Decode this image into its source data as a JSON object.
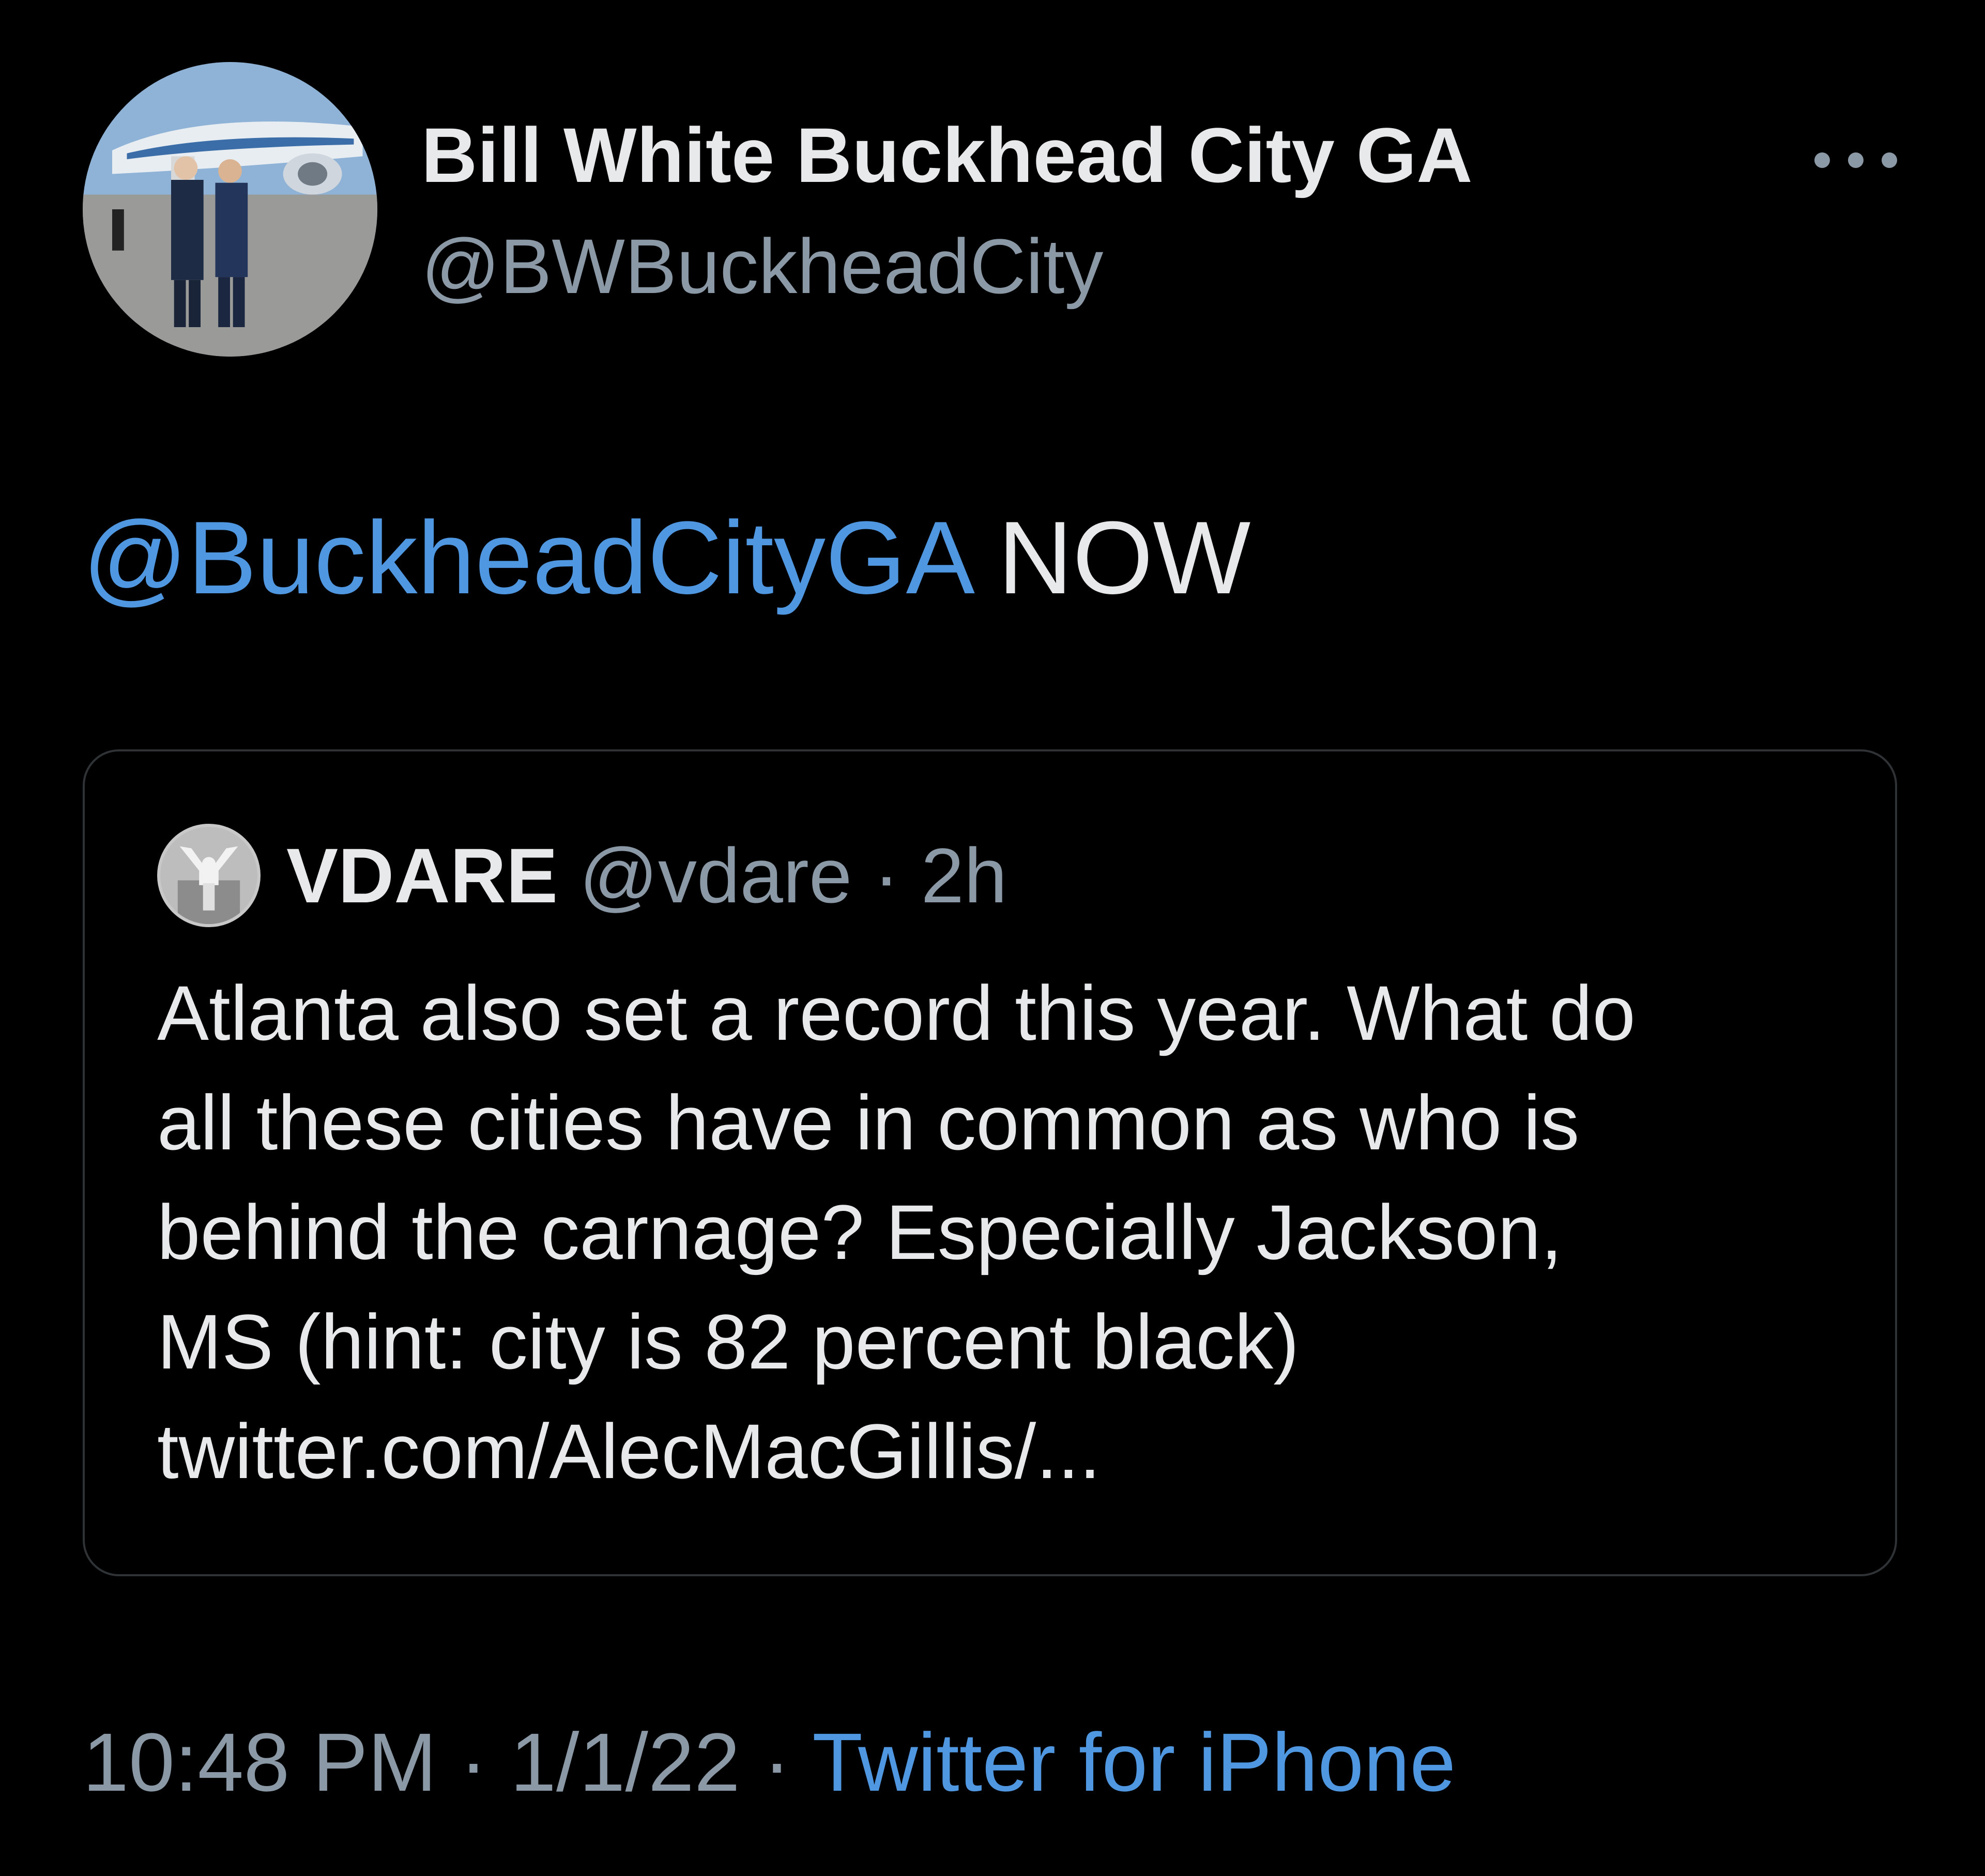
{
  "author": {
    "display_name": "Bill White Buckhead City GA",
    "handle": "@BWBuckheadCity"
  },
  "tweet": {
    "mention": "@BuckheadCityGA",
    "text": " NOW"
  },
  "quoted_tweet": {
    "display_name": "VDARE",
    "meta": " @vdare · 2h",
    "body_lines": [
      "Atlanta also set a record this year. What do",
      "all these cities have in common as who is",
      "behind the carnage? Especially Jackson,",
      "MS (hint: city is 82 percent black)",
      "twitter.com/AlecMacGillis/..."
    ]
  },
  "footer": {
    "time": "10:48 PM",
    "date": "1/1/22",
    "separator": " · ",
    "source": "Twitter for iPhone"
  },
  "icons": {
    "more": "more-horizontal-icon"
  },
  "colors": {
    "background": "#000000",
    "primary_text": "#e7e9ea",
    "secondary_text": "#8b98a5",
    "link": "#4f97e0",
    "border": "#2f3336"
  }
}
